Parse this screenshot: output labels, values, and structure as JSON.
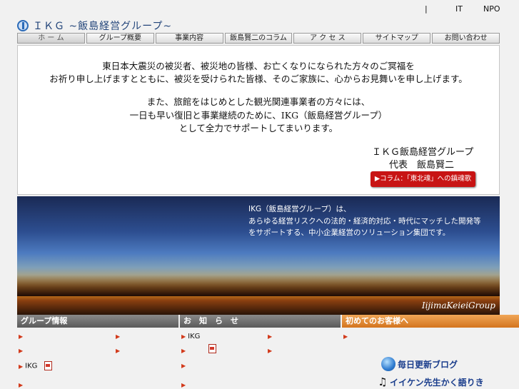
{
  "top_links": [
    "|",
    "IT",
    "NPO"
  ],
  "logo": {
    "text": "ＩＫＧ ~飯島経営グループ~"
  },
  "nav": [
    "ホ ー ム",
    "グループ概要",
    "事業内容",
    "飯島賢二のコラム",
    "ア ク セ ス",
    "サイトマップ",
    "お問い合わせ"
  ],
  "message": {
    "lines": [
      "東日本大震災の被災者、被災地の皆様、お亡くなりになられた方々のご冥福を",
      "お祈り申し上げますとともに、被災を受けられた皆様、そのご家族に、心からお見舞いを申し上げます。",
      "また、旅館をはじめとした観光関連事業者の方々には、",
      "一日も早い復旧と事業継続のために、IKG（飯島経営グループ）",
      "として全力でサポートしてまいります。"
    ],
    "signature_org": "ＩＫＧ飯島経営グループ",
    "signature_name": "代表　飯島賢二",
    "column_button": "▶コラム：「東北魂」への鎮魂歌"
  },
  "banner": {
    "lines": [
      "IKG（飯島経営グループ）は、",
      "あらゆる経営リスクへの法的・経済的対応・時代にマッチした開発等",
      "をサポートする、中小企業経営のソリューション集団です。"
    ],
    "brand": "IijimaKeieiGroup"
  },
  "sections": {
    "group": "グループ情報",
    "news": "お　知　ら　せ",
    "first": "初めてのお客様へ"
  },
  "items": {
    "ikg_label_1": "IKG",
    "ikg_label_2": "IKG"
  },
  "blog_label": "毎日更新ブログ",
  "lecture_label": "イイケン先生かく語りき"
}
